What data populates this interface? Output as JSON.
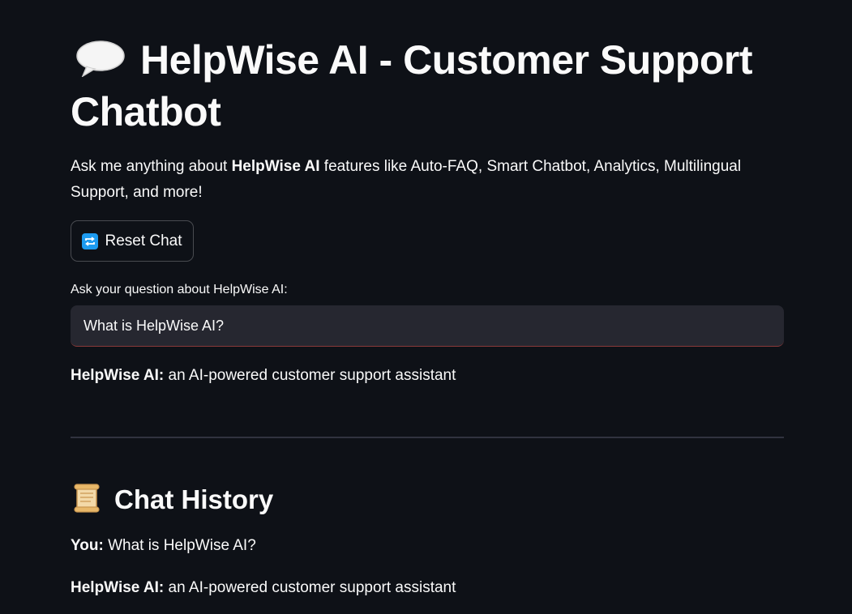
{
  "header": {
    "title": "HelpWise AI - Customer Support Chatbot",
    "title_icon": "speech-balloon-icon"
  },
  "intro": {
    "prefix": "Ask me anything about ",
    "brand": "HelpWise AI",
    "suffix": " features like Auto-FAQ, Smart Chatbot, Analytics, Multilingual Support, and more!"
  },
  "reset_button": {
    "label": "Reset Chat",
    "icon": "repeat-arrows-icon"
  },
  "question": {
    "label": "Ask your question about HelpWise AI:",
    "value": "What is HelpWise AI?"
  },
  "response": {
    "speaker": "HelpWise AI:",
    "text": " an AI-powered customer support assistant"
  },
  "history": {
    "title": "Chat History",
    "title_icon": "scroll-icon",
    "messages": [
      {
        "speaker": "You:",
        "text": " What is HelpWise AI?"
      },
      {
        "speaker": "HelpWise AI:",
        "text": " an AI-powered customer support assistant"
      }
    ]
  }
}
